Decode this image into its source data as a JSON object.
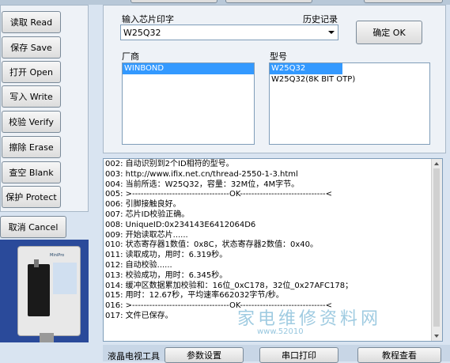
{
  "left_buttons": [
    {
      "label": "读取 Read"
    },
    {
      "label": "保存 Save"
    },
    {
      "label": "打开 Open"
    },
    {
      "label": "写入 Write"
    },
    {
      "label": "校验 Verify"
    },
    {
      "label": "擦除 Erase"
    },
    {
      "label": "查空 Blank"
    },
    {
      "label": "保护 Protect"
    }
  ],
  "cancel_label": "取消 Cancel",
  "chip_input": {
    "label": "输入芯片印字",
    "history_label": "历史记录",
    "value": "W25Q32"
  },
  "ok_label": "确定 OK",
  "vendor": {
    "label": "厂商",
    "items": [
      "WINBOND"
    ]
  },
  "model": {
    "label": "型号",
    "items": [
      "W25Q32",
      "W25Q32(8K BIT OTP)"
    ]
  },
  "device_label": {
    "text": "MiniPro"
  },
  "log_lines": [
    "002: 自动识别到2个ID相符的型号。",
    "003: http://www.ifix.net.cn/thread-2550-1-3.html",
    "004: 当前所选：W25Q32，容量：32M位，4M字节。",
    "005: >----------------------------------OK------------------------------<",
    "006: 引脚接触良好。",
    "007: 芯片ID校验正确。",
    "008: UniqueID:0x234143E6412064D6",
    "009: 开始读取芯片......",
    "010: 状态寄存器1数值：0x8C，状态寄存器2数值：0x40。",
    "011: 读取成功，用时：6.319秒。",
    "012: 自动校验......",
    "013: 校验成功，用时：6.345秒。",
    "014: 缓冲区数据累加校验和：16位_0xC178，32位_0x27AFC178；",
    "015: 用时：12.67秒，平均速率662032字节/秒。",
    "016: >----------------------------------OK------------------------------<",
    "017: 文件已保存。"
  ],
  "bottom": {
    "tv_tool": "液晶电视工具",
    "params": "参数设置",
    "serial": "串口打印",
    "tutorial": "教程查看"
  },
  "watermark": {
    "text": "家电维修资料网",
    "url": "www.52010"
  },
  "colors": {
    "bg": "#d9e4f1",
    "select": "#3399ff"
  }
}
